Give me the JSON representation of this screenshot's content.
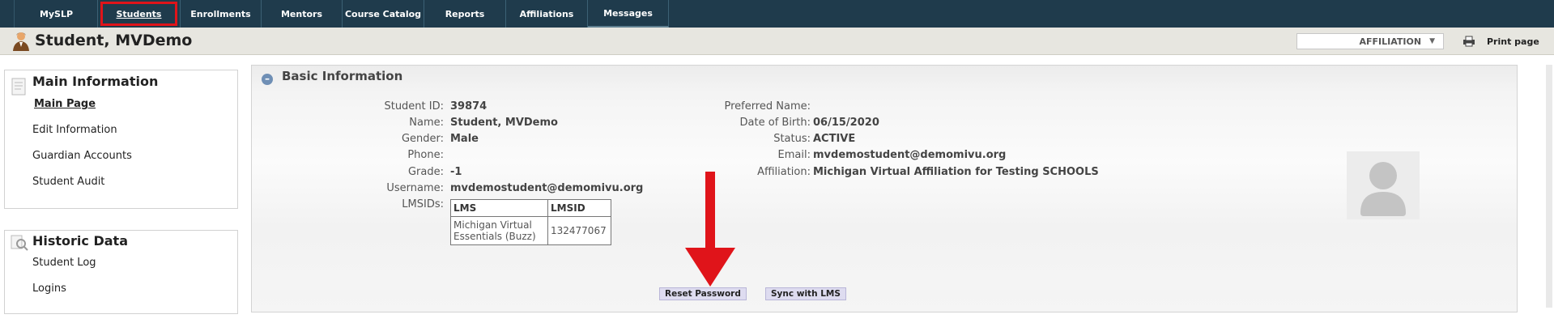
{
  "nav": {
    "tabs": [
      {
        "label": "MySLP"
      },
      {
        "label": "Students"
      },
      {
        "label": "Enrollments"
      },
      {
        "label": "Mentors"
      },
      {
        "label": "Course Catalog"
      },
      {
        "label": "Reports"
      },
      {
        "label": "Affiliations"
      },
      {
        "label": "Messages"
      }
    ],
    "active_tab": "Students"
  },
  "header": {
    "title": "Student, MVDemo",
    "affiliation_select": "AFFILIATION",
    "print_label": "Print page"
  },
  "sidebar": {
    "main": {
      "title": "Main Information",
      "links": [
        {
          "label": "Main Page"
        },
        {
          "label": "Edit Information"
        },
        {
          "label": "Guardian Accounts"
        },
        {
          "label": "Student Audit"
        }
      ],
      "current": "Main Page"
    },
    "historic": {
      "title": "Historic Data",
      "links": [
        {
          "label": "Student Log"
        },
        {
          "label": "Logins"
        }
      ]
    }
  },
  "basic": {
    "title": "Basic Information",
    "left": {
      "student_id": {
        "label": "Student ID:",
        "value": "39874"
      },
      "name": {
        "label": "Name:",
        "value": "Student, MVDemo"
      },
      "gender": {
        "label": "Gender:",
        "value": "Male"
      },
      "phone": {
        "label": "Phone:",
        "value": ""
      },
      "grade": {
        "label": "Grade:",
        "value": "-1"
      },
      "username": {
        "label": "Username:",
        "value": "mvdemostudent@demomivu.org"
      },
      "lmsids": {
        "label": "LMSIDs:"
      }
    },
    "right": {
      "preferred_name": {
        "label": "Preferred Name:",
        "value": ""
      },
      "dob": {
        "label": "Date of Birth:",
        "value": "06/15/2020"
      },
      "status": {
        "label": "Status:",
        "value": "ACTIVE"
      },
      "email": {
        "label": "Email:",
        "value": "mvdemostudent@demomivu.org"
      },
      "affiliation": {
        "label": "Affiliation:",
        "value": "Michigan Virtual Affiliation for Testing SCHOOLS"
      }
    },
    "lms_table": {
      "headers": [
        "LMS",
        "LMSID"
      ],
      "rows": [
        {
          "lms_line1": "Michigan Virtual",
          "lms_line2": "Essentials (Buzz)",
          "lmsid": "132477067"
        }
      ]
    },
    "buttons": {
      "reset_password": "Reset Password",
      "sync_lms": "Sync with LMS"
    }
  },
  "colors": {
    "nav_bg": "#1f3b4c",
    "highlight": "#e0141a",
    "button_bg": "#dedcf0"
  }
}
